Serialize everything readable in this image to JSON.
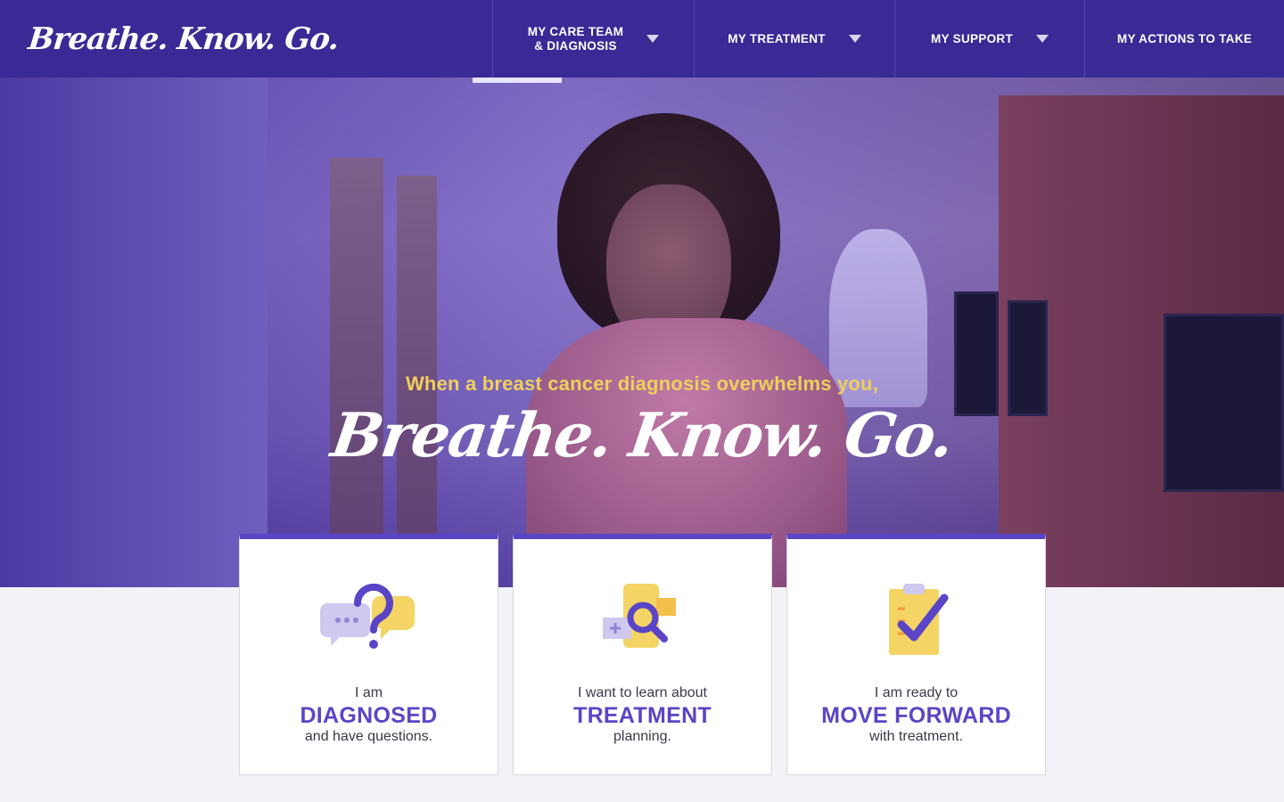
{
  "brand": {
    "logo_text": "Breathe. Know. Go."
  },
  "nav": {
    "items": [
      {
        "label": "MY CARE TEAM\n& DIAGNOSIS",
        "has_dropdown": true
      },
      {
        "label": "MY TREATMENT",
        "has_dropdown": true
      },
      {
        "label": "MY SUPPORT",
        "has_dropdown": true
      },
      {
        "label": "MY ACTIONS TO TAKE",
        "has_dropdown": false
      }
    ]
  },
  "hero": {
    "tagline": "When a breast cancer diagnosis overwhelms you,",
    "title": "Breathe. Know. Go."
  },
  "cards": [
    {
      "lead": "I am",
      "key": "DIAGNOSED",
      "tail": "and have questions.",
      "icon": "question-chat-icon"
    },
    {
      "lead": "I want to learn about",
      "key": "TREATMENT",
      "tail": "planning.",
      "icon": "search-phone-icon"
    },
    {
      "lead": "I am ready to",
      "key": "MOVE FORWARD",
      "tail": "with treatment.",
      "icon": "clipboard-check-icon"
    }
  ],
  "colors": {
    "nav_bg": "#3a2a96",
    "accent_purple": "#5a45c6",
    "tagline_yellow": "#f1cf5a",
    "page_bg": "#f3f2f7"
  }
}
